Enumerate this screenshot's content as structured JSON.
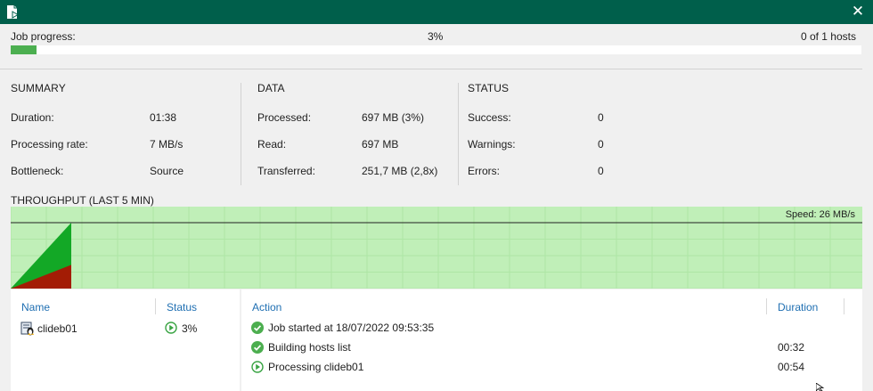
{
  "progress": {
    "label": "Job progress:",
    "percent_text": "3%",
    "percent": 3,
    "hosts_text": "0 of 1 hosts"
  },
  "summary": {
    "heading": "SUMMARY",
    "rows": [
      {
        "label": "Duration:",
        "value": "01:38"
      },
      {
        "label": "Processing rate:",
        "value": "7 MB/s"
      },
      {
        "label": "Bottleneck:",
        "value": "Source"
      }
    ]
  },
  "data_section": {
    "heading": "DATA",
    "rows": [
      {
        "label": "Processed:",
        "value": "697 MB (3%)"
      },
      {
        "label": "Read:",
        "value": "697 MB"
      },
      {
        "label": "Transferred:",
        "value": "251,7 MB (2,8x)"
      }
    ]
  },
  "status_section": {
    "heading": "STATUS",
    "rows": [
      {
        "label": "Success:",
        "value": "0"
      },
      {
        "label": "Warnings:",
        "value": "0"
      },
      {
        "label": "Errors:",
        "value": "0"
      }
    ]
  },
  "throughput": {
    "heading": "THROUGHPUT (LAST 5 MIN)",
    "speed_text": "Speed: 26 MB/s",
    "colors": {
      "background": "#c0efb8",
      "read": "#13a826",
      "transferred": "#a31c05",
      "grid": "#aee6a5"
    }
  },
  "chart_data": {
    "type": "area",
    "title": "THROUGHPUT (LAST 5 MIN)",
    "series": [
      {
        "values": [
          0,
          100
        ]
      },
      {
        "values": [
          0,
          36
        ]
      }
    ]
  },
  "hosts_table": {
    "columns": [
      "Name",
      "Status"
    ],
    "rows": [
      {
        "name": "clideb01",
        "status": "3%",
        "icon": "linux-host-icon",
        "status_icon": "running-play-icon"
      }
    ]
  },
  "actions_table": {
    "columns": [
      "Action",
      "Duration"
    ],
    "rows": [
      {
        "icon": "success-check-icon",
        "action": "Job started at 18/07/2022 09:53:35",
        "duration": ""
      },
      {
        "icon": "success-check-icon",
        "action": "Building hosts list",
        "duration": "00:32"
      },
      {
        "icon": "running-play-icon",
        "action": "Processing clideb01",
        "duration": "00:54"
      }
    ]
  },
  "window": {
    "close_icon": "close-icon",
    "app_icon": "veeam-job-icon",
    "titlebar_color": "#005f4b"
  }
}
